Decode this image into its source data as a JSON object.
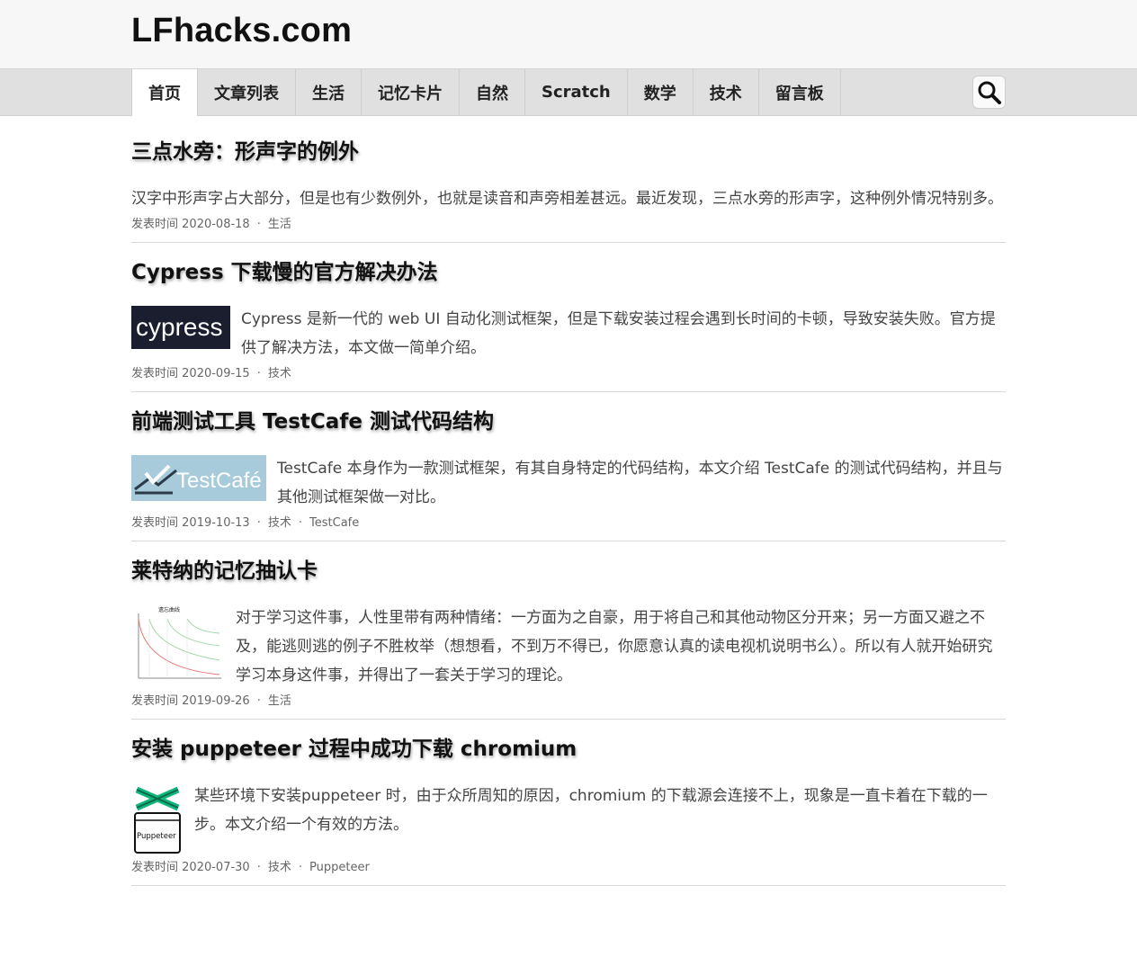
{
  "site": {
    "title": "LFhacks.com"
  },
  "nav": {
    "items": [
      {
        "label": "首页"
      },
      {
        "label": "文章列表"
      },
      {
        "label": "生活"
      },
      {
        "label": "记忆卡片"
      },
      {
        "label": "自然"
      },
      {
        "label": "Scratch"
      },
      {
        "label": "数学"
      },
      {
        "label": "技术"
      },
      {
        "label": "留言板"
      }
    ],
    "search_icon": "search-icon"
  },
  "posts": [
    {
      "title": "三点水旁：形声字的例外",
      "excerpt": "汉字中形声字占大部分，但是也有少数例外，也就是读音和声旁相差甚远。最近发现，三点水旁的形声字，这种例外情况特别多。",
      "date_label": "发表时间",
      "date": "2020-08-18",
      "tags": [
        "生活"
      ]
    },
    {
      "title": "Cypress 下载慢的官方解决办法",
      "thumb": {
        "kind": "cypress-logo",
        "text": "cypress"
      },
      "excerpt": "Cypress 是新一代的 web UI 自动化测试框架，但是下载安装过程会遇到长时间的卡顿，导致安装失败。官方提供了解决方法，本文做一简单介绍。",
      "date_label": "发表时间",
      "date": "2020-09-15",
      "tags": [
        "技术"
      ]
    },
    {
      "title": "前端测试工具 TestCafe 测试代码结构",
      "thumb": {
        "kind": "testcafe-logo",
        "text": "TestCafé"
      },
      "excerpt": "TestCafe 本身作为一款测试框架，有其自身特定的代码结构，本文介绍 TestCafe 的测试代码结构，并且与其他测试框架做一对比。",
      "date_label": "发表时间",
      "date": "2019-10-13",
      "tags": [
        "技术",
        "TestCafe"
      ]
    },
    {
      "title": "莱特纳的记忆抽认卡",
      "thumb": {
        "kind": "forgetting-curve-chart",
        "text": "遗忘曲线"
      },
      "excerpt": "对于学习这件事，人性里带有两种情绪：一方面为之自豪，用于将自己和其他动物区分开来；另一方面又避之不及，能逃则逃的例子不胜枚举（想想看，不到万不得已，你愿意认真的读电视机说明书么）。所以有人就开始研究学习本身这件事，并得出了一套关于学习的理论。",
      "date_label": "发表时间",
      "date": "2019-09-26",
      "tags": [
        "生活"
      ]
    },
    {
      "title": "安装 puppeteer 过程中成功下载 chromium",
      "thumb": {
        "kind": "puppeteer-logo",
        "text": "Puppeteer"
      },
      "excerpt": "某些环境下安装puppeteer 时，由于众所周知的原因，chromium 的下载源会连接不上，现象是一直卡着在下载的一步。本文介绍一个有效的方法。",
      "date_label": "发表时间",
      "date": "2020-07-30",
      "tags": [
        "技术",
        "Puppeteer"
      ]
    }
  ]
}
